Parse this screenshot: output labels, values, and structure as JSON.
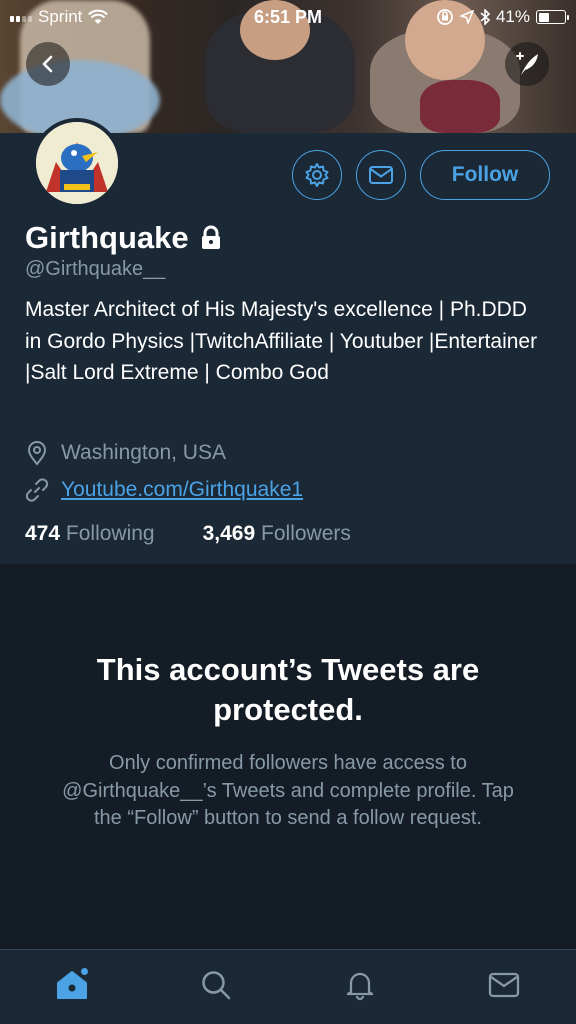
{
  "status_bar": {
    "carrier": "Sprint",
    "time": "6:51 PM",
    "battery": "41%",
    "battery_level": 0.41
  },
  "profile": {
    "display_name": "Girthquake",
    "handle": "@Girthquake__",
    "bio": "Master Architect of His Majesty's excellence | Ph.DDD in Gordo Physics |TwitchAffiliate | Youtuber |Entertainer |Salt Lord Extreme | Combo God",
    "location": "Washington, USA",
    "website": "Youtube.com/Girthquake1",
    "following_count": "474",
    "following_label": "Following",
    "followers_count": "3,469",
    "followers_label": "Followers",
    "follow_button": "Follow"
  },
  "protected_notice": {
    "title": "This account’s Tweets are protected.",
    "body": "Only confirmed followers have access to @Girthquake__’s Tweets and complete profile. Tap the “Follow” button to send a follow request."
  },
  "icons": {
    "back": "back-arrow-icon",
    "compose": "compose-tweet-icon",
    "settings": "gear-icon",
    "message": "envelope-icon",
    "lock": "lock-icon",
    "location": "location-pin-icon",
    "link": "link-icon",
    "home": "home-icon",
    "search": "search-icon",
    "notifications": "bell-icon",
    "messages": "mail-icon"
  },
  "colors": {
    "accent": "#4ba3e5",
    "background": "#141d26",
    "panel": "#1b2836",
    "muted_text": "#8899a6"
  }
}
